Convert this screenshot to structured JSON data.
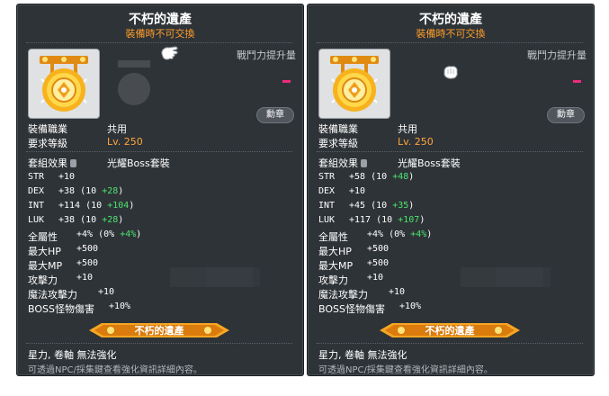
{
  "panels": [
    {
      "title": "不朽的遺產",
      "subtitle": "裝備時不可交換",
      "power_label": "戰鬥力提升量",
      "medal_button": "勳章",
      "job_label": "裝備職業",
      "job_value": "共用",
      "level_label": "要求等級",
      "level_value": "Lv. 250",
      "set_label": "套組效果",
      "set_name": "光耀Boss套裝",
      "stats": [
        {
          "label": "STR",
          "value": "+10",
          "extra": "",
          "bonus": "",
          "tail": ""
        },
        {
          "label": "DEX",
          "value": "+38",
          "extra": "(10 ",
          "bonus": "+28",
          "tail": ")"
        },
        {
          "label": "INT",
          "value": "+114",
          "extra": "(10 ",
          "bonus": "+104",
          "tail": ")"
        },
        {
          "label": "LUK",
          "value": "+38",
          "extra": "(10 ",
          "bonus": "+28",
          "tail": ")"
        },
        {
          "label": "全屬性",
          "value": "+4%",
          "extra": "(0% ",
          "bonus": "+4%",
          "tail": ")"
        },
        {
          "label": "最大HP",
          "value": "+500",
          "extra": "",
          "bonus": "",
          "tail": ""
        },
        {
          "label": "最大MP",
          "value": "+500",
          "extra": "",
          "bonus": "",
          "tail": ""
        },
        {
          "label": "攻擊力",
          "value": "+10",
          "extra": "",
          "bonus": "",
          "tail": ""
        },
        {
          "label": "魔法攻擊力",
          "value": "+10",
          "extra": "",
          "bonus": "",
          "tail": ""
        },
        {
          "label": "BOSS怪物傷害",
          "value": "+10%",
          "extra": "",
          "bonus": "",
          "tail": ""
        }
      ],
      "legacy_badge": "不朽的遺產",
      "enhance_text": "星力, 卷軸 無法強化",
      "note_text": "可透過NPC/採集鍵查看強化資訊詳細內容。"
    },
    {
      "title": "不朽的遺產",
      "subtitle": "裝備時不可交換",
      "power_label": "戰鬥力提升量",
      "medal_button": "勳章",
      "job_label": "裝備職業",
      "job_value": "共用",
      "level_label": "要求等級",
      "level_value": "Lv. 250",
      "set_label": "套組效果",
      "set_name": "光耀Boss套裝",
      "stats": [
        {
          "label": "STR",
          "value": "+58",
          "extra": "(10 ",
          "bonus": "+48",
          "tail": ")"
        },
        {
          "label": "DEX",
          "value": "+10",
          "extra": "",
          "bonus": "",
          "tail": ""
        },
        {
          "label": "INT",
          "value": "+45",
          "extra": "(10 ",
          "bonus": "+35",
          "tail": ")"
        },
        {
          "label": "LUK",
          "value": "+117",
          "extra": "(10 ",
          "bonus": "+107",
          "tail": ")"
        },
        {
          "label": "全屬性",
          "value": "+4%",
          "extra": "(0% ",
          "bonus": "+4%",
          "tail": ")"
        },
        {
          "label": "最大HP",
          "value": "+500",
          "extra": "",
          "bonus": "",
          "tail": ""
        },
        {
          "label": "最大MP",
          "value": "+500",
          "extra": "",
          "bonus": "",
          "tail": ""
        },
        {
          "label": "攻擊力",
          "value": "+10",
          "extra": "",
          "bonus": "",
          "tail": ""
        },
        {
          "label": "魔法攻擊力",
          "value": "+10",
          "extra": "",
          "bonus": "",
          "tail": ""
        },
        {
          "label": "BOSS怪物傷害",
          "value": "+10%",
          "extra": "",
          "bonus": "",
          "tail": ""
        }
      ],
      "legacy_badge": "不朽的遺產",
      "enhance_text": "星力, 卷軸 無法強化",
      "note_text": "可透過NPC/採集鍵查看強化資訊詳細內容。"
    }
  ],
  "colors": {
    "panel_bg": "#2e3337",
    "subtitle": "#ff9c2a",
    "level": "#ffa63e",
    "bonus_green": "#4be36f",
    "power_dash": "#ee2a7b",
    "badge_gold": "#f6a623"
  },
  "icons": [
    "legacy-medal-icon",
    "glove-cursor-icon",
    "lock-icon",
    "sparkle-badge-icon"
  ]
}
